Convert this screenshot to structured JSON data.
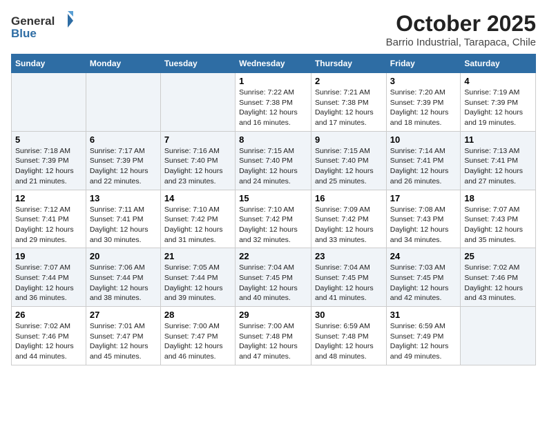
{
  "header": {
    "logo_general": "General",
    "logo_blue": "Blue",
    "title": "October 2025",
    "subtitle": "Barrio Industrial, Tarapaca, Chile"
  },
  "days_of_week": [
    "Sunday",
    "Monday",
    "Tuesday",
    "Wednesday",
    "Thursday",
    "Friday",
    "Saturday"
  ],
  "weeks": [
    [
      {
        "day": "",
        "info": ""
      },
      {
        "day": "",
        "info": ""
      },
      {
        "day": "",
        "info": ""
      },
      {
        "day": "1",
        "info": "Sunrise: 7:22 AM\nSunset: 7:38 PM\nDaylight: 12 hours and 16 minutes."
      },
      {
        "day": "2",
        "info": "Sunrise: 7:21 AM\nSunset: 7:38 PM\nDaylight: 12 hours and 17 minutes."
      },
      {
        "day": "3",
        "info": "Sunrise: 7:20 AM\nSunset: 7:39 PM\nDaylight: 12 hours and 18 minutes."
      },
      {
        "day": "4",
        "info": "Sunrise: 7:19 AM\nSunset: 7:39 PM\nDaylight: 12 hours and 19 minutes."
      }
    ],
    [
      {
        "day": "5",
        "info": "Sunrise: 7:18 AM\nSunset: 7:39 PM\nDaylight: 12 hours and 21 minutes."
      },
      {
        "day": "6",
        "info": "Sunrise: 7:17 AM\nSunset: 7:39 PM\nDaylight: 12 hours and 22 minutes."
      },
      {
        "day": "7",
        "info": "Sunrise: 7:16 AM\nSunset: 7:40 PM\nDaylight: 12 hours and 23 minutes."
      },
      {
        "day": "8",
        "info": "Sunrise: 7:15 AM\nSunset: 7:40 PM\nDaylight: 12 hours and 24 minutes."
      },
      {
        "day": "9",
        "info": "Sunrise: 7:15 AM\nSunset: 7:40 PM\nDaylight: 12 hours and 25 minutes."
      },
      {
        "day": "10",
        "info": "Sunrise: 7:14 AM\nSunset: 7:41 PM\nDaylight: 12 hours and 26 minutes."
      },
      {
        "day": "11",
        "info": "Sunrise: 7:13 AM\nSunset: 7:41 PM\nDaylight: 12 hours and 27 minutes."
      }
    ],
    [
      {
        "day": "12",
        "info": "Sunrise: 7:12 AM\nSunset: 7:41 PM\nDaylight: 12 hours and 29 minutes."
      },
      {
        "day": "13",
        "info": "Sunrise: 7:11 AM\nSunset: 7:41 PM\nDaylight: 12 hours and 30 minutes."
      },
      {
        "day": "14",
        "info": "Sunrise: 7:10 AM\nSunset: 7:42 PM\nDaylight: 12 hours and 31 minutes."
      },
      {
        "day": "15",
        "info": "Sunrise: 7:10 AM\nSunset: 7:42 PM\nDaylight: 12 hours and 32 minutes."
      },
      {
        "day": "16",
        "info": "Sunrise: 7:09 AM\nSunset: 7:42 PM\nDaylight: 12 hours and 33 minutes."
      },
      {
        "day": "17",
        "info": "Sunrise: 7:08 AM\nSunset: 7:43 PM\nDaylight: 12 hours and 34 minutes."
      },
      {
        "day": "18",
        "info": "Sunrise: 7:07 AM\nSunset: 7:43 PM\nDaylight: 12 hours and 35 minutes."
      }
    ],
    [
      {
        "day": "19",
        "info": "Sunrise: 7:07 AM\nSunset: 7:44 PM\nDaylight: 12 hours and 36 minutes."
      },
      {
        "day": "20",
        "info": "Sunrise: 7:06 AM\nSunset: 7:44 PM\nDaylight: 12 hours and 38 minutes."
      },
      {
        "day": "21",
        "info": "Sunrise: 7:05 AM\nSunset: 7:44 PM\nDaylight: 12 hours and 39 minutes."
      },
      {
        "day": "22",
        "info": "Sunrise: 7:04 AM\nSunset: 7:45 PM\nDaylight: 12 hours and 40 minutes."
      },
      {
        "day": "23",
        "info": "Sunrise: 7:04 AM\nSunset: 7:45 PM\nDaylight: 12 hours and 41 minutes."
      },
      {
        "day": "24",
        "info": "Sunrise: 7:03 AM\nSunset: 7:45 PM\nDaylight: 12 hours and 42 minutes."
      },
      {
        "day": "25",
        "info": "Sunrise: 7:02 AM\nSunset: 7:46 PM\nDaylight: 12 hours and 43 minutes."
      }
    ],
    [
      {
        "day": "26",
        "info": "Sunrise: 7:02 AM\nSunset: 7:46 PM\nDaylight: 12 hours and 44 minutes."
      },
      {
        "day": "27",
        "info": "Sunrise: 7:01 AM\nSunset: 7:47 PM\nDaylight: 12 hours and 45 minutes."
      },
      {
        "day": "28",
        "info": "Sunrise: 7:00 AM\nSunset: 7:47 PM\nDaylight: 12 hours and 46 minutes."
      },
      {
        "day": "29",
        "info": "Sunrise: 7:00 AM\nSunset: 7:48 PM\nDaylight: 12 hours and 47 minutes."
      },
      {
        "day": "30",
        "info": "Sunrise: 6:59 AM\nSunset: 7:48 PM\nDaylight: 12 hours and 48 minutes."
      },
      {
        "day": "31",
        "info": "Sunrise: 6:59 AM\nSunset: 7:49 PM\nDaylight: 12 hours and 49 minutes."
      },
      {
        "day": "",
        "info": ""
      }
    ]
  ]
}
